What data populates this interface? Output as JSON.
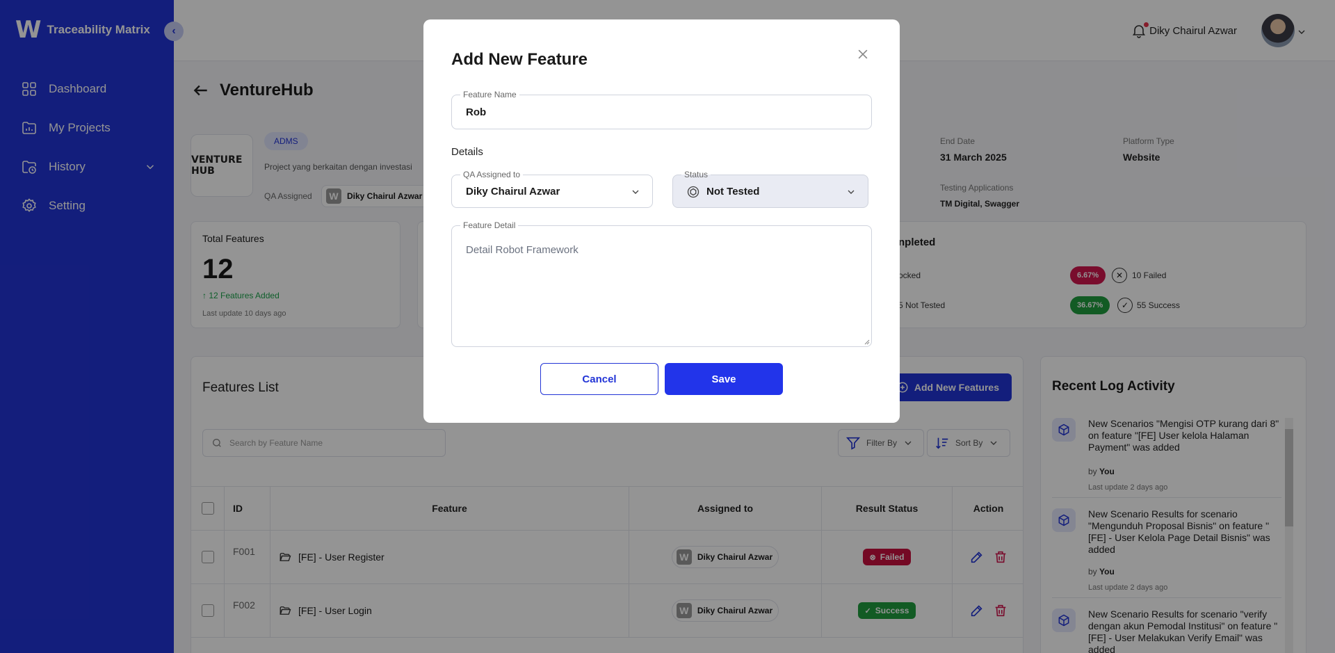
{
  "app": {
    "title": "Traceability Matrix",
    "logo_letter": "W"
  },
  "sidebar": {
    "items": [
      {
        "label": "Dashboard",
        "icon": "grid-icon"
      },
      {
        "label": "My Projects",
        "icon": "folder-chart-icon"
      },
      {
        "label": "History",
        "icon": "history-icon"
      },
      {
        "label": "Setting",
        "icon": "gear-icon"
      }
    ]
  },
  "topbar": {
    "user_name": "Diky Chairul Azwar"
  },
  "project": {
    "name": "VentureHub",
    "logo_text": "VENTURE HUB",
    "badge": "ADMS",
    "description": "Project yang berkaitan dengan investasi",
    "qa_label": "QA Assigned",
    "qa_name": "Diky Chairul Azwar",
    "end_date_label": "End Date",
    "end_date": "31 March 2025",
    "platform_label": "Platform Type",
    "platform": "Website",
    "testing_apps_label": "Testing Applications",
    "testing_apps": "TM Digital, Swagger"
  },
  "stats": {
    "total_label": "Total Features",
    "total_value": "12",
    "added": "12 Features Added",
    "last_update": "Last update 10 days ago",
    "completed_title": "npleted",
    "blocked_partial": "ocked",
    "not_tested_partial": "5 Not Tested",
    "failed_pct": "6.67%",
    "failed_text": "10 Failed",
    "success_pct": "36.67%",
    "success_text": "55 Success",
    "colors": {
      "failed": "#d1174f",
      "success": "#1f9d3f"
    }
  },
  "features_list": {
    "title": "Features List",
    "add_button": "Add New Features",
    "search_placeholder": "Search by Feature Name",
    "filter_label": "Filter By",
    "sort_label": "Sort By",
    "columns": [
      "ID",
      "Feature",
      "Assigned to",
      "Result Status",
      "Action"
    ],
    "rows": [
      {
        "id": "F001",
        "feature": "[FE] - User Register",
        "assigned": "Diky Chairul Azwar",
        "status": "Failed"
      },
      {
        "id": "F002",
        "feature": "[FE] - User Login",
        "assigned": "Diky Chairul Azwar",
        "status": "Success"
      }
    ]
  },
  "log": {
    "title": "Recent Log Activity",
    "items": [
      {
        "text": "New Scenarios \"Mengisi OTP kurang dari 8\" on feature \"[FE] User kelola Halaman Payment\" was added",
        "by_label": "by",
        "by": "You",
        "time": "Last update 2 days ago"
      },
      {
        "text": "New Scenario Results for scenario \"Mengunduh Proposal Bisnis\" on feature \"[FE] - User Kelola Page Detail Bisnis\" was added",
        "by_label": "by",
        "by": "You",
        "time": "Last update 2 days ago"
      },
      {
        "text": "New Scenario Results for scenario \"verify dengan akun Pemodal Institusi\" on feature \"[FE] - User Melakukan Verify Email\" was added",
        "by_label": "",
        "by": "",
        "time": ""
      }
    ]
  },
  "modal": {
    "title": "Add New Feature",
    "feature_name_label": "Feature Name",
    "feature_name_value": "Rob",
    "details_label": "Details",
    "qa_label": "QA Assigned to",
    "qa_value": "Diky Chairul Azwar",
    "status_label": "Status",
    "status_value": "Not Tested",
    "detail_label": "Feature Detail",
    "detail_placeholder": "Detail Robot Framework",
    "cancel": "Cancel",
    "save": "Save"
  }
}
